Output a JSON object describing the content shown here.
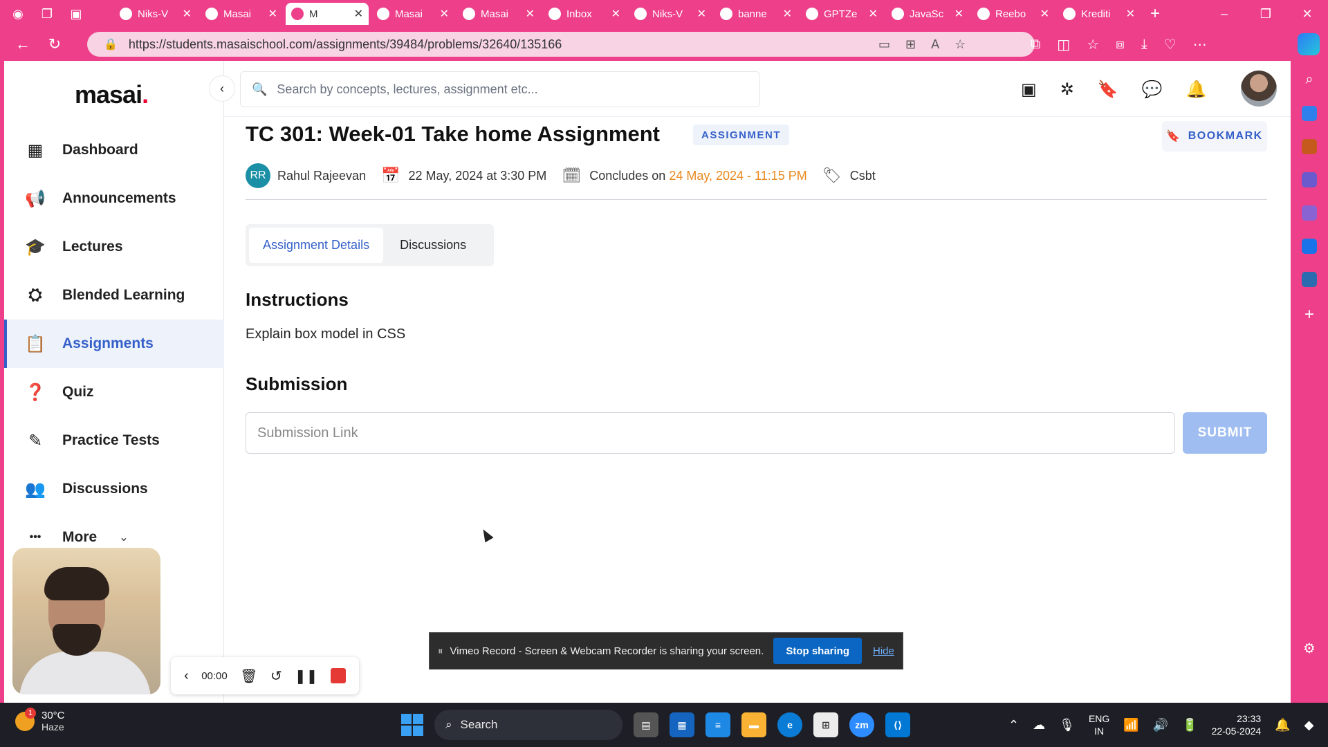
{
  "browser": {
    "tabs": [
      {
        "title": "Niks-V",
        "favicon": "github-icon"
      },
      {
        "title": "Masai",
        "favicon": "masai-icon"
      },
      {
        "title": "M",
        "favicon": "masai-icon",
        "active": true
      },
      {
        "title": "Masai",
        "favicon": "masai-icon"
      },
      {
        "title": "Masai",
        "favicon": "pin-icon"
      },
      {
        "title": "Inbox",
        "favicon": "gmail-icon"
      },
      {
        "title": "Niks-V",
        "favicon": "github-icon"
      },
      {
        "title": "banne",
        "favicon": "info-icon"
      },
      {
        "title": "GPTZe",
        "favicon": "gptzero-icon"
      },
      {
        "title": "JavaSc",
        "favicon": "chatgpt-icon"
      },
      {
        "title": "Reebo",
        "favicon": "reebo-icon"
      },
      {
        "title": "Krediti",
        "favicon": "kredit-icon"
      }
    ],
    "url": "https://students.masaischool.com/assignments/39484/problems/32640/135166"
  },
  "app": {
    "logo_text": "masai",
    "logo_dot": ".",
    "search_placeholder": "Search by concepts, lectures, assignment etc...",
    "nav": [
      {
        "label": "Dashboard",
        "icon": "dashboard-icon",
        "glyph": "▦"
      },
      {
        "label": "Announcements",
        "icon": "megaphone-icon",
        "glyph": "📢"
      },
      {
        "label": "Lectures",
        "icon": "graduation-cap-icon",
        "glyph": "🎓"
      },
      {
        "label": "Blended Learning",
        "icon": "person-desk-icon",
        "glyph": "⛭"
      },
      {
        "label": "Assignments",
        "icon": "clipboard-icon",
        "glyph": "📋",
        "active": true
      },
      {
        "label": "Quiz",
        "icon": "quiz-icon",
        "glyph": "❓"
      },
      {
        "label": "Practice Tests",
        "icon": "tools-icon",
        "glyph": "✎"
      },
      {
        "label": "Discussions",
        "icon": "people-icon",
        "glyph": "👥"
      },
      {
        "label": "More",
        "icon": "more-icon",
        "glyph": "•••"
      }
    ]
  },
  "assignment": {
    "title": "TC 301: Week-01 Take home Assignment",
    "badge": "ASSIGNMENT",
    "bookmark_label": "BOOKMARK",
    "author_initials": "RR",
    "author": "Rahul Rajeevan",
    "start": "22 May, 2024 at 3:30 PM",
    "concludes_label": "Concludes on",
    "concludes_date": "24 May, 2024 - 11:15 PM",
    "tag": "Csbt",
    "tabs": [
      "Assignment Details",
      "Discussions"
    ],
    "instructions_heading": "Instructions",
    "instructions_text": "Explain box model in CSS",
    "submission_heading": "Submission",
    "submission_placeholder": "Submission Link",
    "submit_label": "SUBMIT"
  },
  "recorder": {
    "time": "00:00",
    "share_message": "Vimeo Record - Screen & Webcam Recorder is sharing your screen.",
    "stop_label": "Stop sharing",
    "hide_label": "Hide"
  },
  "taskbar": {
    "temp": "30°C",
    "condition": "Haze",
    "notif_count": "1",
    "search_label": "Search",
    "lang1": "ENG",
    "lang2": "IN",
    "time": "23:33",
    "date": "22-05-2024"
  },
  "colors": {
    "brand": "#ee3f8a",
    "accent": "#3560c9",
    "concludes": "#e8891d"
  }
}
